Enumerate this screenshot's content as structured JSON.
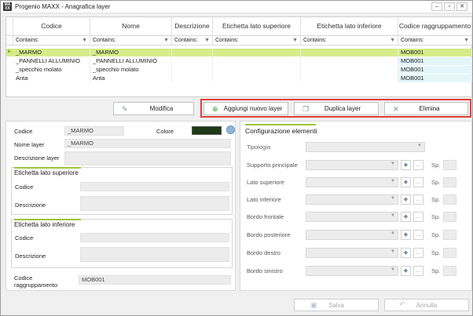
{
  "window": {
    "title": "Progenio MAXX - Anagrafica layer",
    "app_icon": "MA XX"
  },
  "window_controls": {
    "minimize": "–",
    "maximize": "▫",
    "close": "✕"
  },
  "grid": {
    "columns": [
      "Codice",
      "Nome",
      "Descrizione",
      "Etichetta lato superiore",
      "Etichetta lato inferiore",
      "Codice raggruppamento"
    ],
    "filter_label": "Contains:",
    "rows": [
      {
        "codice": "_MARMO",
        "nome": "_MARMO",
        "descrizione": "",
        "sup": "",
        "inf": "",
        "gruppo": "MOB001",
        "selected": true
      },
      {
        "codice": "_PANNELLI ALLUMINIO",
        "nome": "_PANNELLI ALLUMINIO",
        "descrizione": "",
        "sup": "",
        "inf": "",
        "gruppo": "MOB001",
        "selected": false
      },
      {
        "codice": "_specchio molato",
        "nome": "_specchio molato",
        "descrizione": "",
        "sup": "",
        "inf": "",
        "gruppo": "MOB001",
        "selected": false
      },
      {
        "codice": "Anta",
        "nome": "Anta",
        "descrizione": "",
        "sup": "",
        "inf": "",
        "gruppo": "MOB001",
        "selected": false
      }
    ]
  },
  "toolbar": {
    "modifica": "Modifica",
    "aggiungi": "Aggiungi nuovo layer",
    "duplica": "Duplica layer",
    "elimina": "Elimina"
  },
  "details": {
    "codice_label": "Codice",
    "codice_value": "_MARMO",
    "colore_label": "Colore",
    "colore_value": "#1c3a16",
    "nome_label": "Nome layer",
    "nome_value": "_MARMO",
    "descrizione_label": "Descrizione layer",
    "sup_group_title": "Etichetta lato superiore",
    "inf_group_title": "Etichetta lato inferiore",
    "sub_codice_label": "Codice",
    "sub_descrizione_label": "Descrizione",
    "raggr_label_1": "Codice",
    "raggr_label_2": "raggruppamento",
    "raggr_value": "MOB001"
  },
  "config": {
    "title": "Configurazione elementi",
    "tipologia_label": "Tipologia",
    "items": [
      "Supporto principale",
      "Lato superiore",
      "Lato inferiore",
      "Bordo frontale",
      "Bordo posteriore",
      "Bordo destro",
      "Bordo sinistro"
    ],
    "dots_label": "...",
    "sp_label": "Sp."
  },
  "footer": {
    "salva": "Salva",
    "annulla": "Annulla"
  },
  "accent_color": "#9bc53d",
  "highlight_color": "#e0403a"
}
